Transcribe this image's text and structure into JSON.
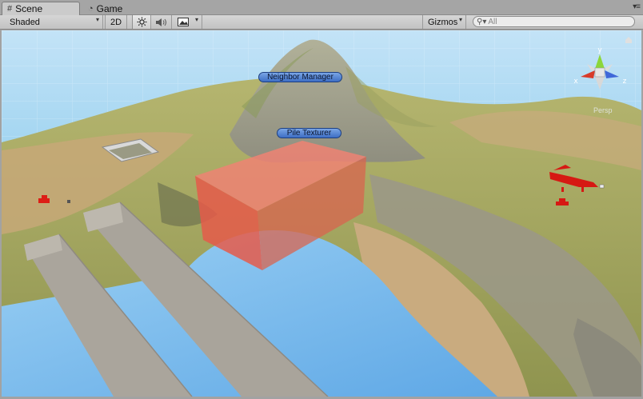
{
  "tabs": [
    {
      "label": "Scene",
      "icon": "grid-icon"
    },
    {
      "label": "Game",
      "icon": "pacman-icon"
    }
  ],
  "toolbar": {
    "shading_mode": "Shaded",
    "two_d_label": "2D",
    "gizmos_label": "Gizmos",
    "search_placeholder": "All"
  },
  "scene_labels": {
    "neighbor_manager": "Neighbor Manager",
    "pile_texturer": "Pile Texturer"
  },
  "gizmo": {
    "axis_y": "y",
    "axis_x": "x",
    "axis_z": "z",
    "projection": "Persp"
  },
  "colors": {
    "sky": "#a6d4f4",
    "sea": "#5cbbe6",
    "terrain": "#a8aa66",
    "sand": "#c9a978",
    "rock": "#9a9788",
    "water_plane": "#84c1ec",
    "trigger_box": "#e8604f",
    "ramp": "#a8a39a",
    "unit_red": "#dd1e16"
  }
}
